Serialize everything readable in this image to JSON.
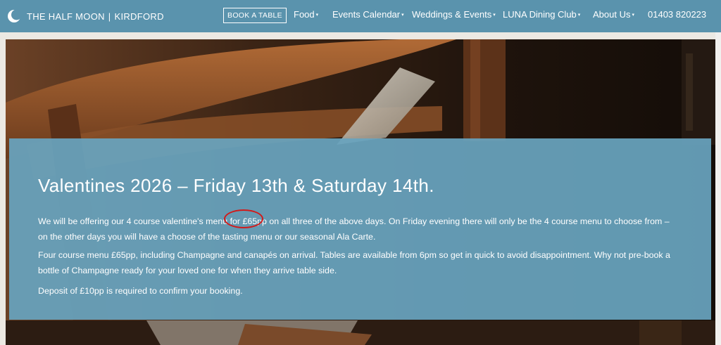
{
  "brand": {
    "name": "THE HALF MOON",
    "separator": "|",
    "location": "KIRDFORD"
  },
  "nav": {
    "book_label": "BOOK A TABLE",
    "items": [
      {
        "label": "Food",
        "has_dropdown": true
      },
      {
        "label": "Events Calendar",
        "has_dropdown": true
      },
      {
        "label": "Weddings & Events",
        "has_dropdown": true
      },
      {
        "label": "LUNA Dining Club",
        "has_dropdown": true
      },
      {
        "label": "About Us",
        "has_dropdown": true
      }
    ],
    "caret": "▾",
    "phone": "01403 820223"
  },
  "panel": {
    "title": "Valentines 2026 – Friday 13th & Saturday 14th.",
    "p1_before": "We will be offering our 4 course valentine's menu for ",
    "p1_price": "£65pp",
    "p1_after": " on all three of the above days. On Friday evening there will only be the 4 course menu to choose from – on the other days you will have a choose of the tasting menu or our seasonal Ala Carte.",
    "p2": "Four course menu £65pp, including Champagne and canapés on arrival. Tables are available from 6pm so get in quick to avoid disappointment. Why not pre-book a bottle of Champagne ready for your loved one for when they arrive table side.",
    "p3": "Deposit of £10pp is required to confirm your booking."
  },
  "colors": {
    "nav_bg": "#5a93ad",
    "panel_bg": "#68a4be",
    "annotation": "#d11a1a"
  }
}
